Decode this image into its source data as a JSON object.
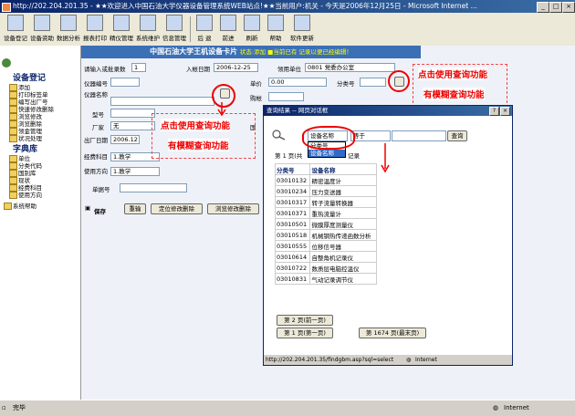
{
  "window": {
    "title": "http://202.204.201.35 - ★★欢迎进入中国石油大学仪器设备管理系统WEB站点!★★当前用户:机关 - 今天是2006年12月25日 - Microsoft Internet ...",
    "minimize": "_",
    "maximize": "□",
    "close": "×"
  },
  "toolbar": {
    "items": [
      "设备登记",
      "设备资助",
      "数据分析",
      "报表打印",
      "精仪管理",
      "系统维护",
      "信息管理",
      "后 退",
      "前进",
      "刷新",
      "帮助",
      "软件更新"
    ]
  },
  "sidebar": {
    "group1": "设备登记",
    "group1_items": [
      "添加",
      "打印标签单",
      "编写出厂号",
      "快速修改删除",
      "浏览修改",
      "浏览删除",
      "领金管理",
      "状况处理"
    ],
    "group2": "字典库",
    "group2_items": [
      "单位",
      "分类代码",
      "国别库",
      "现状",
      "经费科目",
      "使用方向"
    ],
    "group3": "系统帮助"
  },
  "card": {
    "title": "中国石油大学王机设备卡片",
    "status_label": "状态:",
    "status_value": "添加 ■当前已有 记录以便已经编辑！",
    "fields": {
      "entry_count_label": "请输入或批录数",
      "entry_count_value": "1",
      "entry_date_label": "入帐日期",
      "entry_date_value": "2006-12-25",
      "unit_label": "领用单位",
      "unit_value": "0801 党委办公室",
      "device_no_label": "仪器编号",
      "price_label": "单价",
      "price_value": "0.00",
      "category_label": "分类号",
      "device_name_label": "仪器名称",
      "buyer_label": "购帐",
      "model_label": "型号",
      "factory_label": "厂家",
      "factory_value": "无",
      "country_label": "国",
      "factory_date_label": "出厂日期",
      "factory_date_value": "2006.12",
      "funding_label": "经费科目",
      "funding_value": "1.教学",
      "direction_label": "使用方向",
      "direction_value": "1.教学",
      "doc_no_label": "单据号",
      "save_label": "保存",
      "reset_label": "重输",
      "locate_edit_label": "定位修改删除",
      "browse_edit_label": "浏览修改删除"
    }
  },
  "annotations": {
    "left_line1": "点击使用查询功能",
    "left_line2": "有模糊查询功能",
    "right_line1": "点击使用查询功能",
    "right_line2": "有模糊查询功能"
  },
  "popup": {
    "title": "查询结果 -- 网页对话框",
    "field_select": "设备名称",
    "operator_select": "等于",
    "search_button": "查询",
    "dropdown_options": [
      "分类号",
      "设备名称"
    ],
    "page_info": "第 1 页(共",
    "page_info_tail": "记录",
    "col_code": "分类号",
    "col_name": "设备名称",
    "rows": [
      [
        "03010132",
        "精密温度计"
      ],
      [
        "03010234",
        "压力变送器"
      ],
      [
        "03010317",
        "转子流量转换器"
      ],
      [
        "03010371",
        "重热流量计"
      ],
      [
        "03010501",
        "微膜厚度测量仪"
      ],
      [
        "03010518",
        "机械钢热传递函数分析"
      ],
      [
        "03010555",
        "位移信号器"
      ],
      [
        "03010614",
        "自整角机记录仪"
      ],
      [
        "03010722",
        "数质层电脑控温仪"
      ],
      [
        "03010831",
        "气动记录调节仪"
      ]
    ],
    "nav_prev": "第 2 页(前一页)",
    "nav_first": "第 1 页(第一页)",
    "nav_last": "第 1674 页(最末页)",
    "status_url": "http://202.204.201.35/findgbm.asp?sql=select",
    "status_zone": "Internet"
  },
  "statusbar": {
    "left": "完毕",
    "zone": "Internet"
  },
  "colors": {
    "accent": "#3b6fb6",
    "annotation": "#e00000"
  }
}
